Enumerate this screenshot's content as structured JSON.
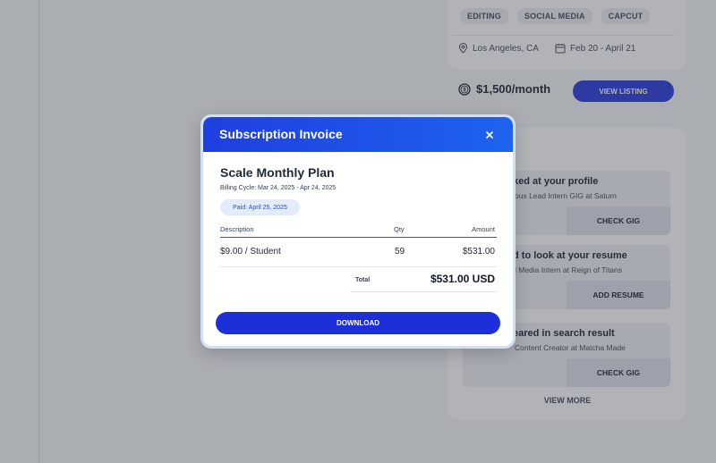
{
  "listing": {
    "tags": [
      "EDITING",
      "SOCIAL MEDIA",
      "CAPCUT"
    ],
    "location": "Los Angeles, CA",
    "dates": "Feb 20 - April 21",
    "salary": "$1,500/month",
    "view_listing_label": "VIEW LISTING"
  },
  "notifications": [
    {
      "title": "ked at your profile",
      "sub": "ous Lead Intern GIG at Saturn",
      "left_label": "",
      "right_label": "CHECK GIG"
    },
    {
      "title": "d to look at your resume",
      "sub": "l Media Intern at Reign of Titans",
      "left_label": "",
      "right_label": "ADD RESUME"
    },
    {
      "title": "eared in search result",
      "sub": "Content Creator at Matcha Made",
      "left_label": "",
      "right_label": "CHECK GIG"
    }
  ],
  "view_more_label": "VIEW MORE",
  "modal": {
    "title": "Subscription Invoice",
    "plan_name": "Scale Monthly Plan",
    "billing_cycle": "Billing Cycle: Mar 24, 2025 - Apr 24, 2025",
    "paid_badge": "Paid: April 25, 2025",
    "columns": {
      "description": "Description",
      "qty": "Qty",
      "amount": "Amount"
    },
    "row": {
      "description": "$9.00 / Student",
      "qty": "59",
      "amount": "$531.00"
    },
    "total_label": "Total",
    "total_value": "$531.00 USD",
    "download_label": "DOWNLOAD"
  },
  "colors": {
    "primary": "#1c2fd9",
    "header_gradient_start": "#1f3fe0",
    "header_gradient_end": "#1e63ef"
  }
}
